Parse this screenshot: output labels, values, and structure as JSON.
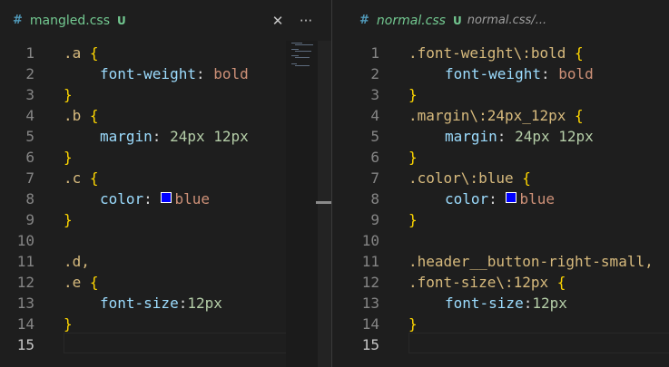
{
  "left_editor": {
    "tab": {
      "icon": "css-hash-icon",
      "hash": "#",
      "filename": "mangled.css",
      "status": "U"
    },
    "actions": {
      "close": "✕",
      "more": "···"
    },
    "lines": [
      {
        "n": "1"
      },
      {
        "n": "2"
      },
      {
        "n": "3"
      },
      {
        "n": "4"
      },
      {
        "n": "5"
      },
      {
        "n": "6"
      },
      {
        "n": "7"
      },
      {
        "n": "8"
      },
      {
        "n": "9"
      },
      {
        "n": "10"
      },
      {
        "n": "11"
      },
      {
        "n": "12"
      },
      {
        "n": "13"
      },
      {
        "n": "14"
      },
      {
        "n": "15"
      }
    ],
    "code": {
      "l1_sel": ".a ",
      "l1_br": "{",
      "l2_prop": "font-weight",
      "l2_colon": ": ",
      "l2_val": "bold",
      "l3_br": "}",
      "l4_sel": ".b ",
      "l4_br": "{",
      "l5_prop": "margin",
      "l5_colon": ": ",
      "l5_val": "24px 12px",
      "l6_br": "}",
      "l7_sel": ".c ",
      "l7_br": "{",
      "l8_prop": "color",
      "l8_colon": ": ",
      "l8_val": "blue",
      "l9_br": "}",
      "l11_sel": ".d,",
      "l12_sel": ".e ",
      "l12_br": "{",
      "l13_prop": "font-size",
      "l13_colon": ":",
      "l13_val": "12px",
      "l14_br": "}"
    }
  },
  "right_editor": {
    "tab": {
      "icon": "css-hash-icon",
      "hash": "#",
      "filename": "normal.css",
      "status": "U",
      "description": "normal.css/..."
    },
    "lines": [
      {
        "n": "1"
      },
      {
        "n": "2"
      },
      {
        "n": "3"
      },
      {
        "n": "4"
      },
      {
        "n": "5"
      },
      {
        "n": "6"
      },
      {
        "n": "7"
      },
      {
        "n": "8"
      },
      {
        "n": "9"
      },
      {
        "n": "10"
      },
      {
        "n": "11"
      },
      {
        "n": "12"
      },
      {
        "n": "13"
      },
      {
        "n": "14"
      },
      {
        "n": "15"
      }
    ],
    "code": {
      "l1_sel": ".font-weight\\:bold ",
      "l1_br": "{",
      "l2_prop": "font-weight",
      "l2_colon": ": ",
      "l2_val": "bold",
      "l3_br": "}",
      "l4_sel": ".margin\\:24px_12px ",
      "l4_br": "{",
      "l5_prop": "margin",
      "l5_colon": ": ",
      "l5_val": "24px 12px",
      "l6_br": "}",
      "l7_sel": ".color\\:blue ",
      "l7_br": "{",
      "l8_prop": "color",
      "l8_colon": ": ",
      "l8_val": "blue",
      "l9_br": "}",
      "l11_sel": ".header__button-right-small,",
      "l12_sel": ".font-size\\:12px ",
      "l12_br": "{",
      "l13_prop": "font-size",
      "l13_colon": ":",
      "l13_val": "12px",
      "l14_br": "}"
    }
  },
  "colors": {
    "background": "#1e1e1e",
    "selector": "#d7ba7d",
    "bracket": "#ffd700",
    "property": "#9cdcfe",
    "value_string": "#ce9178",
    "value_number": "#b5cea8",
    "untracked": "#73c991",
    "swatch_blue": "#0000ff"
  }
}
